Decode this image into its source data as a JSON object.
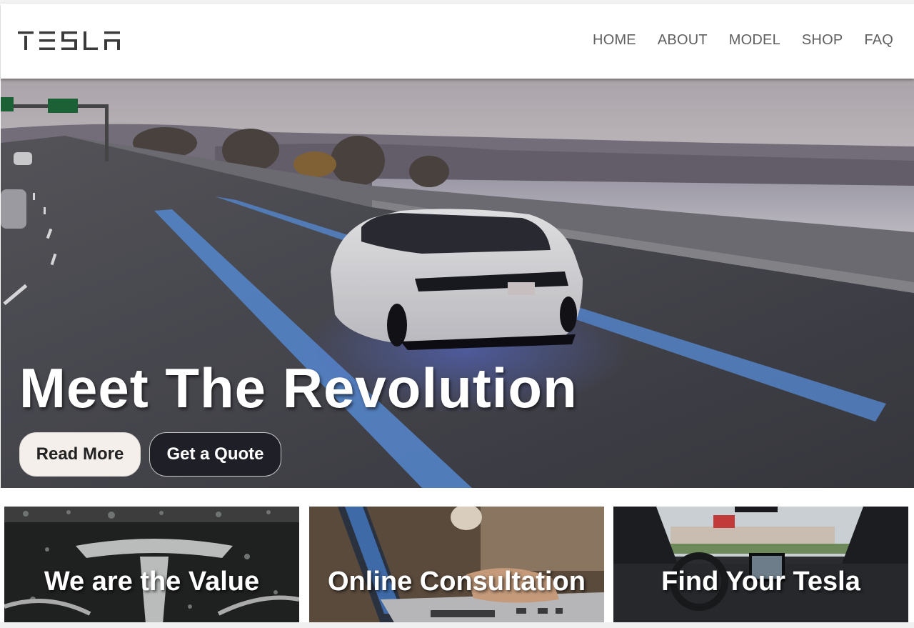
{
  "brand": {
    "logo_text": "TESLA"
  },
  "nav": {
    "items": [
      "HOME",
      "ABOUT",
      "MODEL",
      "SHOP",
      "FAQ"
    ]
  },
  "hero": {
    "title": "Meet The Revolution",
    "read_more_label": "Read More",
    "quote_label": "Get a Quote"
  },
  "cards": [
    {
      "title": "We are the Value"
    },
    {
      "title": "Online Consultation"
    },
    {
      "title": "Find Your Tesla"
    }
  ],
  "colors": {
    "nav_text": "#5f5f5f",
    "read_more_bg": "#f4efea",
    "quote_bg": "#1f1f28",
    "lane_highlight": "#5b8fd8"
  }
}
